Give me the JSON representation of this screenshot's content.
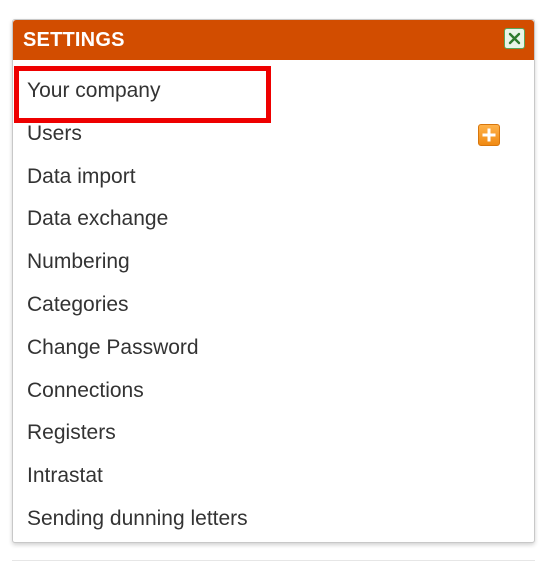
{
  "panel": {
    "title": "SETTINGS",
    "close_icon": "close-x-icon",
    "colors": {
      "header": "#d24d00",
      "highlight": "#ee0000",
      "add_button": "#f08a13"
    }
  },
  "menu": {
    "items": [
      {
        "label": "Your company"
      },
      {
        "label": "Users"
      },
      {
        "label": "Data import"
      },
      {
        "label": "Data exchange"
      },
      {
        "label": "Numbering"
      },
      {
        "label": "Categories"
      },
      {
        "label": "Change Password"
      },
      {
        "label": "Connections"
      },
      {
        "label": "Registers"
      },
      {
        "label": "Intrastat"
      },
      {
        "label": "Sending dunning letters"
      }
    ],
    "users_add_icon": "plus-icon"
  }
}
